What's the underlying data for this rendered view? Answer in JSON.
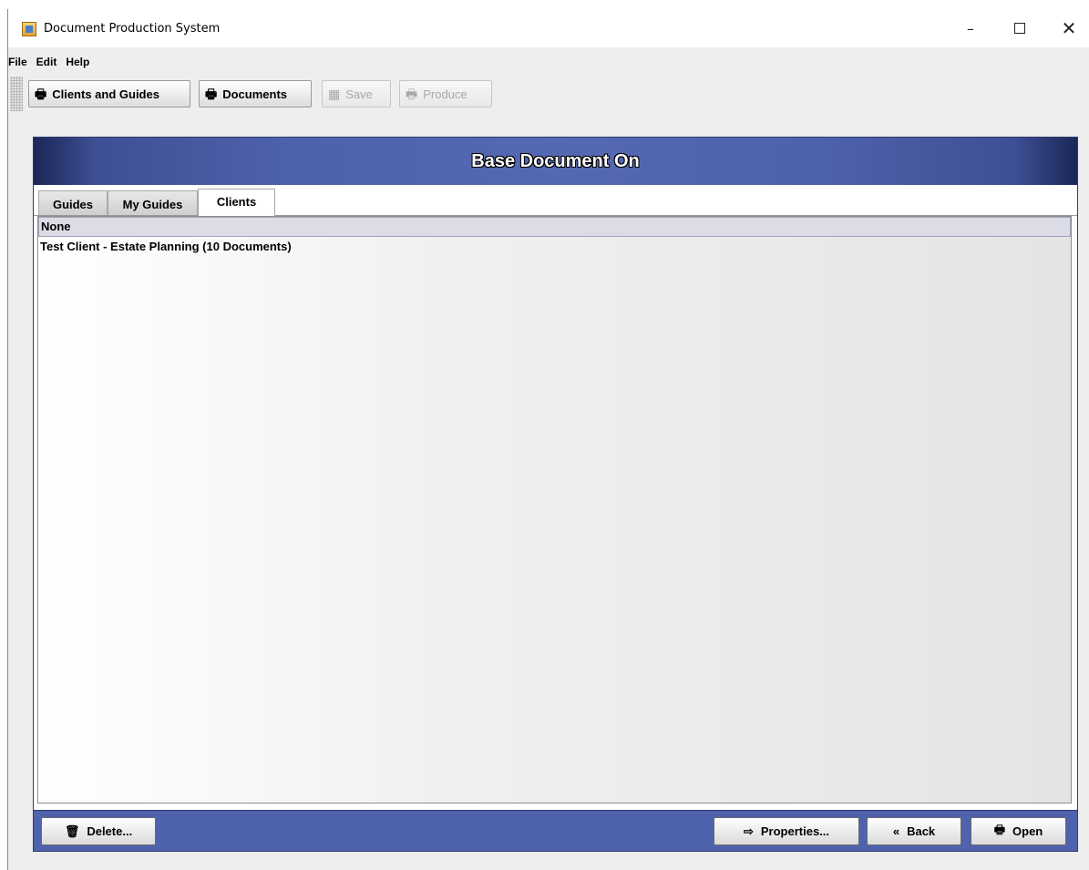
{
  "window": {
    "title": "Document Production System",
    "controls": {
      "minimize": "–",
      "close": "✕"
    }
  },
  "menu": {
    "items": [
      "File",
      "Edit",
      "Help"
    ]
  },
  "toolbar": {
    "buttons": [
      {
        "label": "Clients and Guides",
        "icon": "printer-icon",
        "glyph": "🖶",
        "enabled": true
      },
      {
        "label": "Documents",
        "icon": "printer-icon",
        "glyph": "🖶",
        "enabled": true
      },
      {
        "label": "Save",
        "icon": "database-icon",
        "glyph": "▦",
        "enabled": false
      },
      {
        "label": "Produce",
        "icon": "printer-icon",
        "glyph": "🖶",
        "enabled": false
      }
    ]
  },
  "panel": {
    "title": "Base Document On",
    "tabs": [
      {
        "label": "Guides",
        "active": false
      },
      {
        "label": "My Guides",
        "active": false
      },
      {
        "label": "Clients",
        "active": true
      }
    ],
    "list": [
      {
        "text": "None",
        "selected": true
      },
      {
        "text": "Test Client - Estate Planning (10 Documents)",
        "selected": false
      }
    ],
    "footer": {
      "delete_label": "Delete...",
      "delete_icon": "🗑",
      "properties_label": "Properties...",
      "properties_icon": "⇨",
      "back_label": "Back",
      "back_icon": "«",
      "open_label": "Open",
      "open_icon": "🖶"
    }
  },
  "colors": {
    "header_blue": "#4e62ac",
    "footer_blue": "#4f62ad",
    "selection": "#dcdce6"
  }
}
